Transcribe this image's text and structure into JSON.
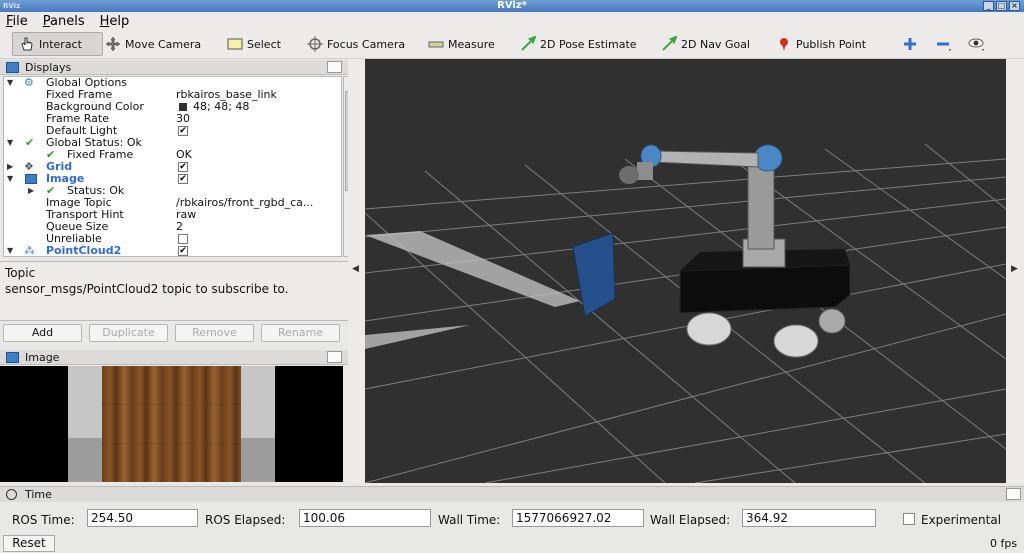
{
  "window": {
    "title": "RViz*",
    "app_icon": "RViz"
  },
  "menu": [
    "File",
    "Panels",
    "Help"
  ],
  "toolbar": {
    "tools": [
      {
        "label": "Interact",
        "icon": "hand-cursor-icon"
      },
      {
        "label": "Move Camera",
        "icon": "move-arrows-icon"
      },
      {
        "label": "Select",
        "icon": "select-rect-icon"
      },
      {
        "label": "Focus Camera",
        "icon": "crosshair-icon"
      },
      {
        "label": "Measure",
        "icon": "ruler-icon"
      },
      {
        "label": "2D Pose Estimate",
        "icon": "green-arrow-icon"
      },
      {
        "label": "2D Nav Goal",
        "icon": "green-arrow-icon"
      },
      {
        "label": "Publish Point",
        "icon": "red-pin-icon"
      }
    ],
    "colors": {
      "pose": "#3fa53f",
      "point": "#d03020",
      "zoom": "#2d72c8"
    }
  },
  "displays": {
    "title": "Displays",
    "rows": [
      {
        "label": "Global Options"
      },
      {
        "label": "Fixed Frame",
        "value": "rbkairos_base_link"
      },
      {
        "label": "Background Color",
        "value": "48; 48; 48",
        "swatch": "#303030"
      },
      {
        "label": "Frame Rate",
        "value": "30"
      },
      {
        "label": "Default Light"
      },
      {
        "label": "Global Status: Ok"
      },
      {
        "label": "Fixed Frame",
        "value": "OK"
      },
      {
        "label": "Grid"
      },
      {
        "label": "Image"
      },
      {
        "label": "Status: Ok"
      },
      {
        "label": "Image Topic",
        "value": "/rbkairos/front_rgbd_ca..."
      },
      {
        "label": "Transport Hint",
        "value": "raw"
      },
      {
        "label": "Queue Size",
        "value": "2"
      },
      {
        "label": "Unreliable"
      },
      {
        "label": "PointCloud2"
      }
    ]
  },
  "description": {
    "title": "Topic",
    "text": "sensor_msgs/PointCloud2 topic to subscribe to."
  },
  "buttons": {
    "add": "Add",
    "duplicate": "Duplicate",
    "remove": "Remove",
    "rename": "Rename"
  },
  "image_panel": {
    "title": "Image"
  },
  "time": {
    "title": "Time",
    "ros_time_label": "ROS Time:",
    "ros_time": "254.50",
    "ros_elapsed_label": "ROS Elapsed:",
    "ros_elapsed": "100.06",
    "wall_time_label": "Wall Time:",
    "wall_time": "1577066927.02",
    "wall_elapsed_label": "Wall Elapsed:",
    "wall_elapsed": "364.92",
    "experimental_label": "Experimental",
    "reset_label": "Reset",
    "fps": "0 fps"
  }
}
